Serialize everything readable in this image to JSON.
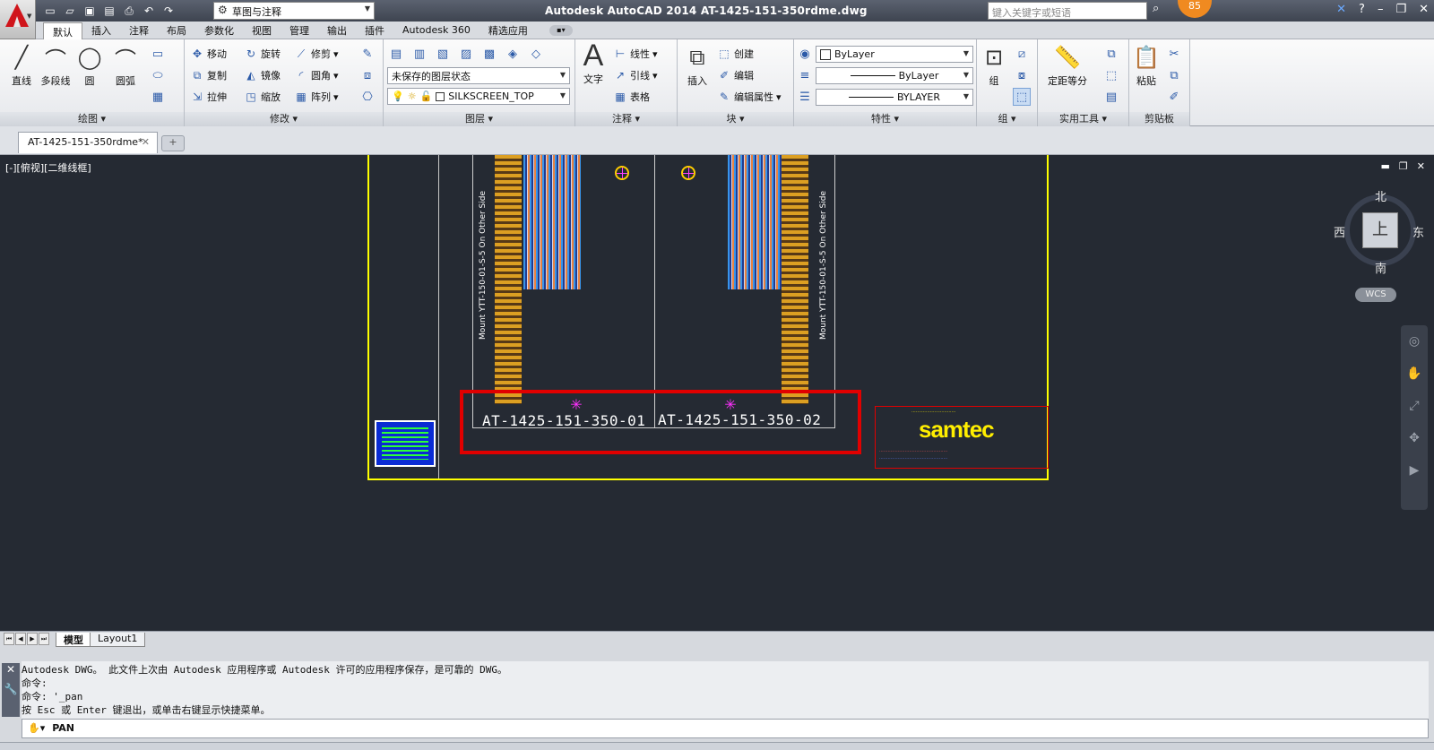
{
  "titlebar": {
    "app_title": "Autodesk AutoCAD 2014    AT-1425-151-350rdme.dwg",
    "workspace": "草图与注释",
    "search_placeholder": "键入关键字或短语",
    "badge_count": "85"
  },
  "ribbon_tabs": [
    "默认",
    "插入",
    "注释",
    "布局",
    "参数化",
    "视图",
    "管理",
    "输出",
    "插件",
    "Autodesk 360",
    "精选应用"
  ],
  "ribbon": {
    "draw": {
      "label": "绘图",
      "line": "直线",
      "polyline": "多段线",
      "circle": "圆",
      "arc": "圆弧"
    },
    "modify": {
      "label": "修改",
      "move": "移动",
      "rotate": "旋转",
      "trim": "修剪",
      "copy": "复制",
      "mirror": "镜像",
      "fillet": "圆角",
      "stretch": "拉伸",
      "scale": "缩放",
      "array": "阵列"
    },
    "layers": {
      "label": "图层",
      "layer_state": "未保存的图层状态",
      "current_layer": "SILKSCREEN_TOP"
    },
    "annotation": {
      "label": "注释",
      "text": "文字",
      "linear": "线性",
      "leader": "引线",
      "table": "表格"
    },
    "block": {
      "label": "块",
      "insert": "插入",
      "create": "创建",
      "edit": "编辑",
      "edit_attr": "编辑属性"
    },
    "properties": {
      "label": "特性",
      "color": "ByLayer",
      "linetype": "ByLayer",
      "lineweight": "BYLAYER"
    },
    "groups": {
      "label": "组",
      "group": "组"
    },
    "utilities": {
      "label": "实用工具",
      "measure": "定距等分"
    },
    "clipboard": {
      "label": "剪贴板",
      "paste": "粘贴"
    }
  },
  "doc_tab": "AT-1425-151-350rdme*",
  "viewport": {
    "label": "[-][俯视][二维线框]",
    "mount_text": "Mount YTT-150-01-S-5 On Other Side",
    "part1": "AT-1425-151-350-01",
    "part2": "AT-1425-151-350-02",
    "logo": "samtec"
  },
  "navcube": {
    "north": "北",
    "south": "南",
    "east": "东",
    "west": "西",
    "top": "上",
    "wcs": "WCS"
  },
  "layout_tabs": [
    "模型",
    "Layout1"
  ],
  "command": {
    "history": [
      "Autodesk DWG。  此文件上次由 Autodesk 应用程序或 Autodesk 许可的应用程序保存，是可靠的 DWG。",
      "命令:",
      "命令: '_pan",
      "按 Esc 或 Enter 键退出，或单击右键显示快捷菜单。"
    ],
    "current": "PAN"
  },
  "colors": {
    "accent_red": "#e10000",
    "sheet_yellow": "#ffff00",
    "canvas_bg": "#252a33"
  }
}
